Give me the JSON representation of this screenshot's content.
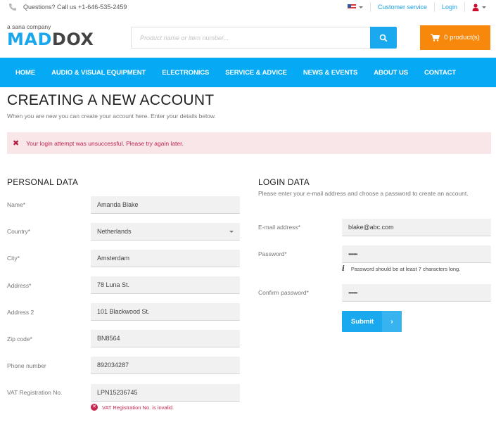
{
  "topbar": {
    "phone_text": "Questions? Call us +1-646-535-2459",
    "language_icon": "us-flag-icon",
    "customer_service": "Customer service",
    "login": "Login",
    "account_icon": "user-icon"
  },
  "header": {
    "logo_tagline": "a sana company",
    "logo_part1": "MAD",
    "logo_part2": "DOX",
    "search_placeholder": "Product name or item number...",
    "search_icon": "search-icon",
    "cart_label": "0 product(s)",
    "colors": {
      "brand_blue": "#1aa9ee",
      "cart_orange": "#f7880c",
      "nav_blue": "#06a9f4",
      "error_red": "#c8264f"
    }
  },
  "nav": {
    "items": [
      "HOME",
      "AUDIO & VISUAL EQUIPMENT",
      "ELECTRONICS",
      "SERVICE & ADVICE",
      "NEWS & EVENTS",
      "ABOUT US",
      "CONTACT"
    ]
  },
  "page": {
    "title": "CREATING A NEW ACCOUNT",
    "intro": "When you are new you can create your account here. Enter your details below.",
    "alert": "Your login attempt was unsuccessful. Please try again later."
  },
  "personal": {
    "title": "PERSONAL DATA",
    "fields": [
      {
        "label": "Name*",
        "value": "Amanda Blake"
      },
      {
        "label": "Country*",
        "value": "Netherlands"
      },
      {
        "label": "City*",
        "value": "Amsterdam"
      },
      {
        "label": "Address*",
        "value": "78 Luna St."
      },
      {
        "label": "Address 2",
        "value": "101 Blackwood St."
      },
      {
        "label": "Zip code*",
        "value": "BN8564"
      },
      {
        "label": "Phone number",
        "value": "892034287"
      },
      {
        "label": "VAT Registration No.",
        "value": "LPN15236745"
      }
    ],
    "vat_error": "VAT Registration No. is invalid."
  },
  "login": {
    "title": "LOGIN DATA",
    "description": "Please enter your e-mail address and choose a password to create an account.",
    "fields": [
      {
        "label": "E-mail address*",
        "value": "blake@abc.com"
      },
      {
        "label": "Password*",
        "value": "•••••••"
      },
      {
        "label": "Confirm password*",
        "value": "•••••••"
      }
    ],
    "password_hint": "Password should be at least 7 characters long.",
    "submit_label": "Submit",
    "submit_arrow": "›"
  }
}
